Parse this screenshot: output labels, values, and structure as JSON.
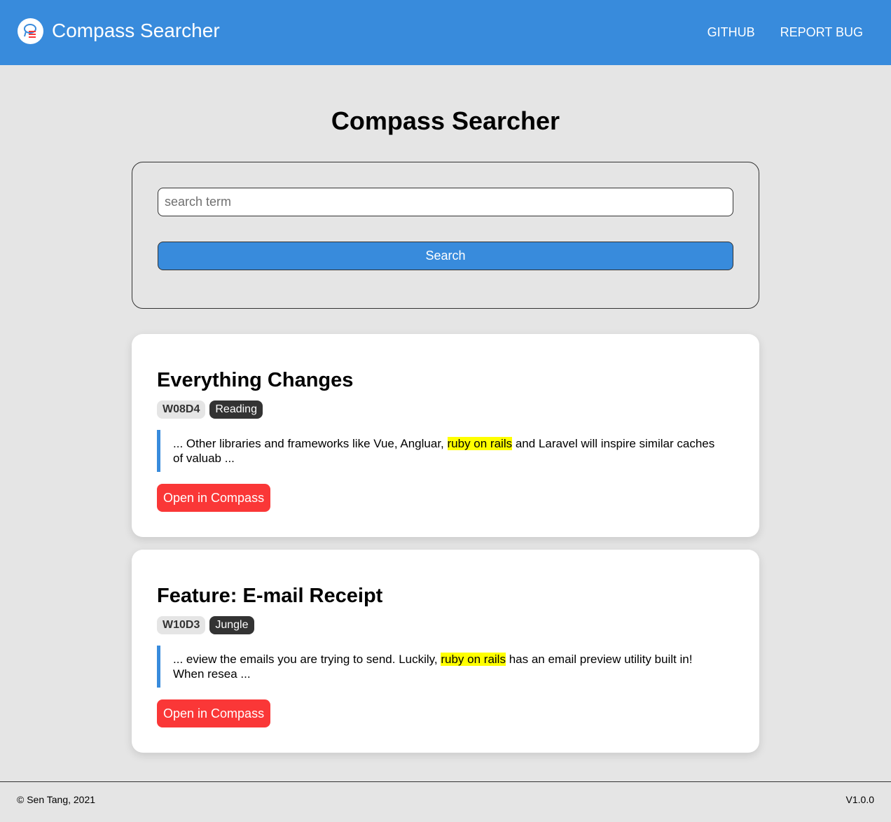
{
  "header": {
    "brand_title": "Compass Searcher",
    "nav": [
      {
        "label": "GITHUB"
      },
      {
        "label": "REPORT BUG"
      }
    ]
  },
  "main": {
    "title": "Compass Searcher",
    "search": {
      "placeholder": "search term",
      "value": "",
      "button_label": "Search"
    },
    "results": [
      {
        "title": "Everything Changes",
        "code": "W08D4",
        "type": "Reading",
        "snippet_before": "... Other libraries and frameworks like Vue, Angluar, ",
        "highlight": "ruby on rails",
        "snippet_after": " and Laravel will inspire similar caches of valuab ...",
        "button_label": "Open in Compass"
      },
      {
        "title": "Feature: E-mail Receipt",
        "code": "W10D3",
        "type": "Jungle",
        "snippet_before": "... eview the emails you are trying to send. Luckily, ",
        "highlight": "ruby on rails",
        "snippet_after": " has an email preview utility built in! When resea ...",
        "button_label": "Open in Compass"
      }
    ]
  },
  "footer": {
    "copyright": "© Sen Tang, 2021",
    "version": "V1.0.0"
  },
  "colors": {
    "primary": "#388bdc",
    "accent": "#fa3737",
    "highlight": "#ffff00",
    "background": "#e5e5e5"
  }
}
